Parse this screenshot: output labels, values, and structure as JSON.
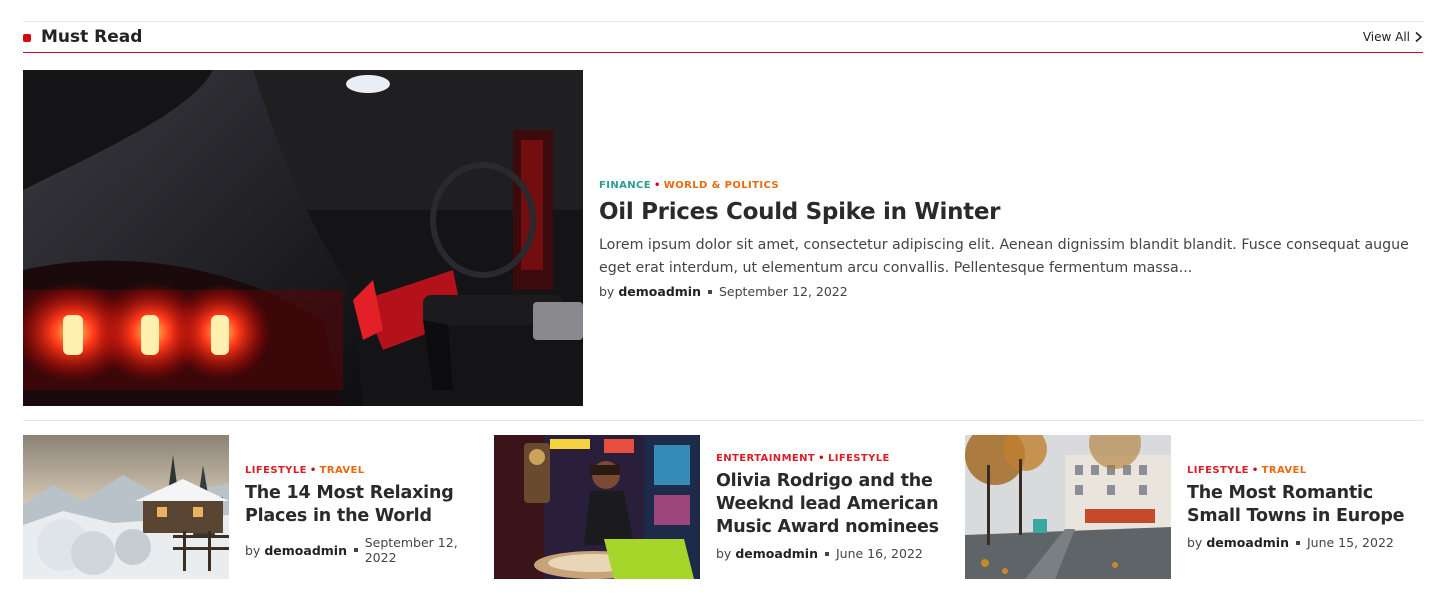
{
  "section": {
    "title": "Must Read",
    "view_all_label": "View All",
    "accent_color": "#d10a10"
  },
  "featured": {
    "image": "car-fuel-pump-photo",
    "categories": [
      "FINANCE",
      "WORLD & POLITICS"
    ],
    "title": "Oil Prices Could Spike in Winter",
    "excerpt": "Lorem ipsum dolor sit amet, consectetur adipiscing elit. Aenean dignissim blandit blandit. Fusce consequat augue eget erat interdum, ut elementum arcu convallis. Pellentesque fermentum massa...",
    "by": "by",
    "author": "demoadmin",
    "date": "September 12, 2022"
  },
  "posts": [
    {
      "image": "snowy-cabin-photo",
      "categories": [
        "LIFESTYLE",
        "TRAVEL"
      ],
      "title": "The 14 Most Relaxing Places in the World",
      "by": "by",
      "author": "demoadmin",
      "date": "September 12, 2022"
    },
    {
      "image": "woman-arcade-phone-photo",
      "categories": [
        "ENTERTAINMENT",
        "LIFESTYLE"
      ],
      "title": "Olivia Rodrigo and the Weeknd lead American Music Award nominees",
      "by": "by",
      "author": "demoadmin",
      "date": "June 16, 2022"
    },
    {
      "image": "autumn-street-tram-photo",
      "categories": [
        "LIFESTYLE",
        "TRAVEL"
      ],
      "title": "The Most Romantic Small Towns in Europe",
      "by": "by",
      "author": "demoadmin",
      "date": "June 15, 2022"
    }
  ]
}
